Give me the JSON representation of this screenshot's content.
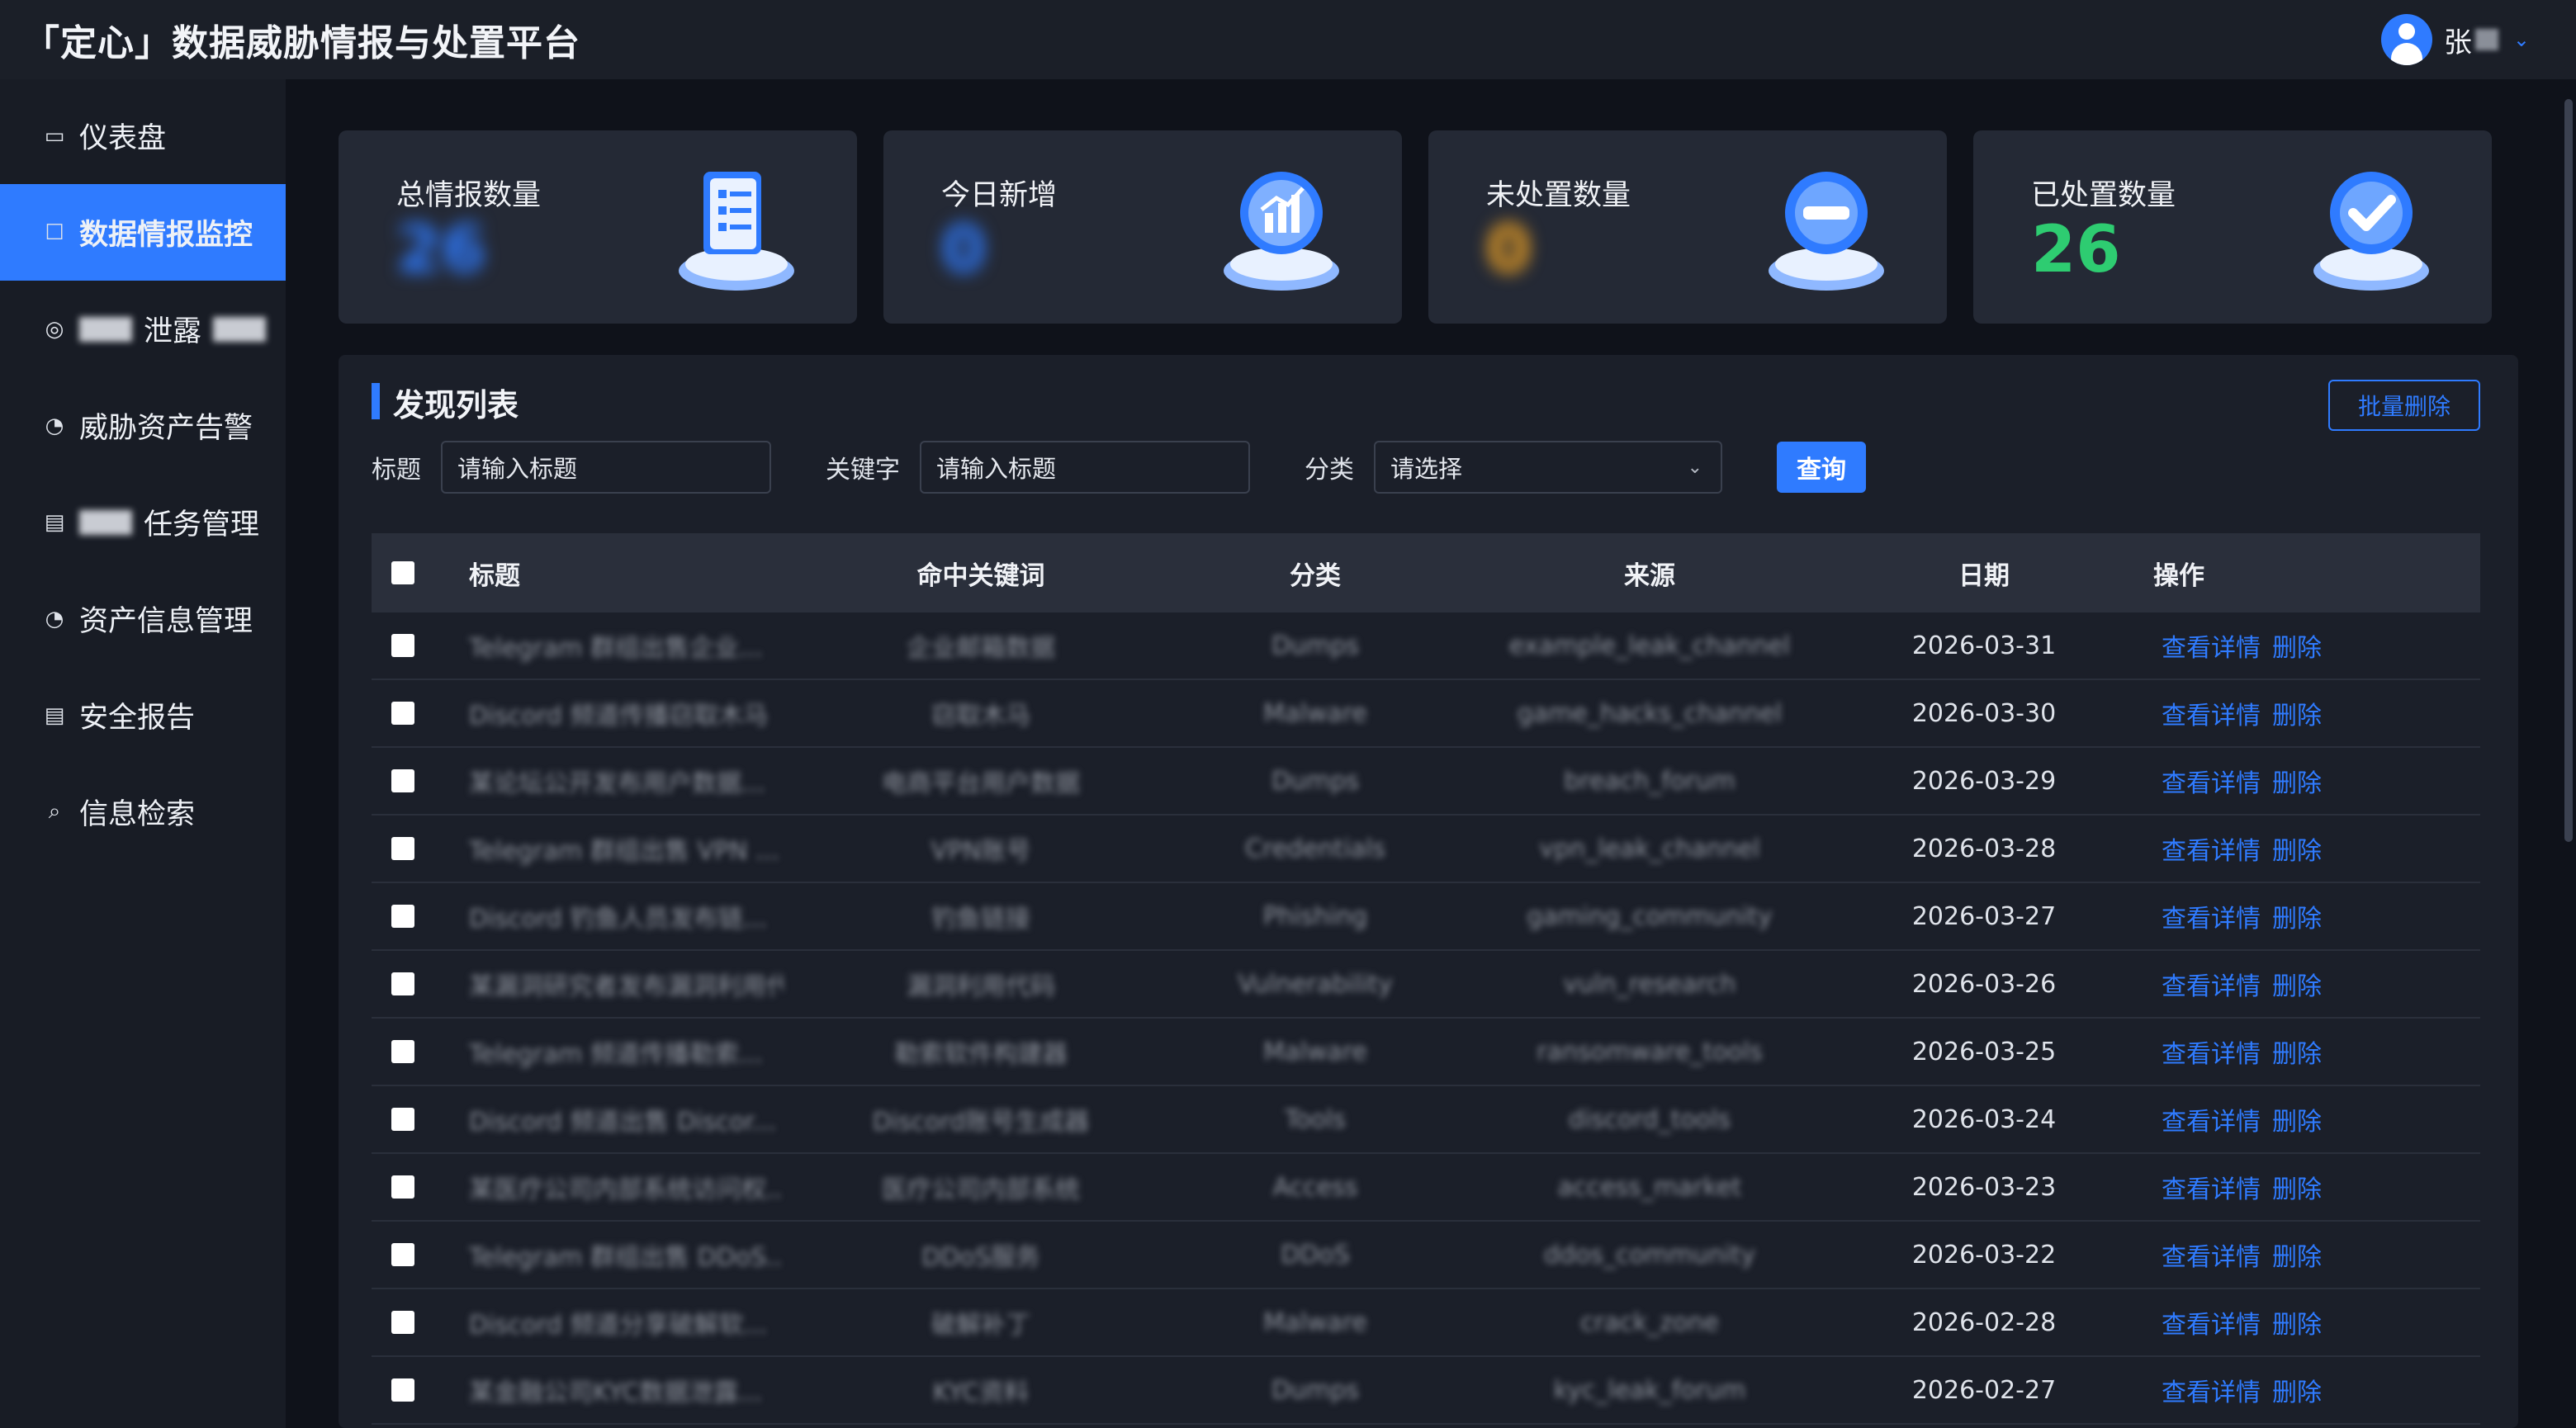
{
  "app": {
    "title": "「定心」数据威胁情报与处置平台"
  },
  "user": {
    "name": "张"
  },
  "sidebar": {
    "items": [
      {
        "label": "仪表盘",
        "icon": "dashboard-icon"
      },
      {
        "label": "数据情报监控",
        "icon": "monitor-icon",
        "active": true
      },
      {
        "label": "泄露",
        "icon": "shield-icon"
      },
      {
        "label": "威胁资产告警",
        "icon": "check-circle-icon"
      },
      {
        "label": "任务管理",
        "icon": "document-icon"
      },
      {
        "label": "资产信息管理",
        "icon": "check-circle-icon"
      },
      {
        "label": "安全报告",
        "icon": "document-icon"
      },
      {
        "label": "信息检索",
        "icon": "search-doc-icon"
      }
    ]
  },
  "stats": [
    {
      "label": "总情报数量",
      "value": "26",
      "color": "#2f7bff",
      "icon": "clipboard-icon"
    },
    {
      "label": "今日新增",
      "value": "0",
      "color": "#2f7bff",
      "icon": "chart-icon"
    },
    {
      "label": "未处置数量",
      "value": "0",
      "color": "#f5a623",
      "icon": "minus-circle-icon"
    },
    {
      "label": "已处置数量",
      "value": "26",
      "color": "#2ecc71",
      "icon": "check-badge-icon"
    }
  ],
  "panel": {
    "title": "发现列表",
    "batch_delete": "批量删除",
    "filters": {
      "title_label": "标题",
      "title_placeholder": "请输入标题",
      "keyword_label": "关键字",
      "keyword_placeholder": "请输入标题",
      "category_label": "分类",
      "category_value": "请选择",
      "query": "查询"
    }
  },
  "table": {
    "headers": [
      "标题",
      "命中关键词",
      "分类",
      "来源",
      "日期",
      "操作"
    ],
    "actions": {
      "view": "查看详情",
      "delete": "删除"
    },
    "rows": [
      {
        "title": "Telegram 群组出售企业...",
        "keyword": "企业邮箱数据",
        "category": "Dumps",
        "source": "example_leak_channel",
        "date": "2026-03-31"
      },
      {
        "title": "Discord 频道传播窃取木马",
        "keyword": "窃取木马",
        "category": "Malware",
        "source": "game_hacks_channel",
        "date": "2026-03-30"
      },
      {
        "title": "某论坛公开发布用户数据...",
        "keyword": "电商平台用户数据",
        "category": "Dumps",
        "source": "breach_forum",
        "date": "2026-03-29"
      },
      {
        "title": "Telegram 群组出售 VPN ...",
        "keyword": "VPN账号",
        "category": "Credentials",
        "source": "vpn_leak_channel",
        "date": "2026-03-28"
      },
      {
        "title": "Discord 钓鱼人员发布链...",
        "keyword": "钓鱼链接",
        "category": "Phishing",
        "source": "gaming_community",
        "date": "2026-03-27"
      },
      {
        "title": "某漏洞研究者发布漏洞利用代码",
        "keyword": "漏洞利用代码",
        "category": "Vulnerability",
        "source": "vuln_research",
        "date": "2026-03-26"
      },
      {
        "title": "Telegram 频道传播勒索...",
        "keyword": "勒索软件构建器",
        "category": "Malware",
        "source": "ransomware_tools",
        "date": "2026-03-25"
      },
      {
        "title": "Discord 频道出售 Discor...",
        "keyword": "Discord账号生成器",
        "category": "Tools",
        "source": "discord_tools",
        "date": "2026-03-24"
      },
      {
        "title": "某医疗公司内部系统访问权...",
        "keyword": "医疗公司内部系统",
        "category": "Access",
        "source": "access_market",
        "date": "2026-03-23"
      },
      {
        "title": "Telegram 群组出售 DDoS...",
        "keyword": "DDoS服务",
        "category": "DDoS",
        "source": "ddos_community",
        "date": "2026-03-22"
      },
      {
        "title": "Discord 频道分享破解软...",
        "keyword": "破解补丁",
        "category": "Malware",
        "source": "crack_zone",
        "date": "2026-02-28"
      },
      {
        "title": "某金融公司KYC数据泄露...",
        "keyword": "KYC资料",
        "category": "Dumps",
        "source": "kyc_leak_forum",
        "date": "2026-02-27"
      }
    ]
  }
}
